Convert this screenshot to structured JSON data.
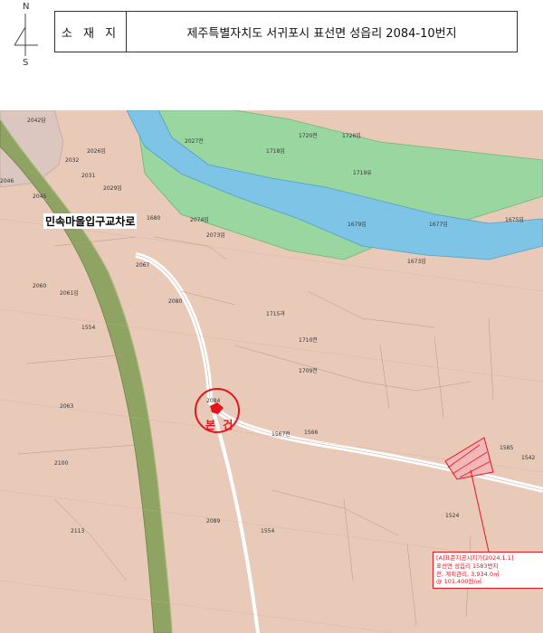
{
  "compass": {
    "north": "N",
    "south": "S"
  },
  "address": {
    "label": "소 재 지",
    "value": "제주특별자치도 서귀포시 표선면 성읍리 2084-10번지"
  },
  "place_label": "민속마을입구교차로",
  "subject_label": "본 건",
  "callout": {
    "line1": "[A]표준지공시지가[2024.1.1]",
    "line2": "표선면 성읍리 1583번지",
    "line3": "전, 계획관리, 3,934.0㎡",
    "line4": "@ 101,400원/㎡"
  },
  "parcel_labels": [
    {
      "text": "2042답",
      "l": 0.05,
      "t": 0.01
    },
    {
      "text": "2027전",
      "l": 0.34,
      "t": 0.05
    },
    {
      "text": "1718임",
      "l": 0.49,
      "t": 0.07
    },
    {
      "text": "1720전",
      "l": 0.55,
      "t": 0.04
    },
    {
      "text": "1726임",
      "l": 0.63,
      "t": 0.04
    },
    {
      "text": "2026임",
      "l": 0.16,
      "t": 0.07
    },
    {
      "text": "2032",
      "l": 0.12,
      "t": 0.09
    },
    {
      "text": "2031",
      "l": 0.15,
      "t": 0.12
    },
    {
      "text": "2029임",
      "l": 0.19,
      "t": 0.14
    },
    {
      "text": "1719유",
      "l": 0.65,
      "t": 0.11
    },
    {
      "text": "2046",
      "l": 0.0,
      "t": 0.13
    },
    {
      "text": "2045",
      "l": 0.06,
      "t": 0.16
    },
    {
      "text": "2074임",
      "l": 0.35,
      "t": 0.2
    },
    {
      "text": "1679임",
      "l": 0.64,
      "t": 0.21
    },
    {
      "text": "1677임",
      "l": 0.79,
      "t": 0.21
    },
    {
      "text": "1675임",
      "l": 0.93,
      "t": 0.2
    },
    {
      "text": "1680",
      "l": 0.27,
      "t": 0.2
    },
    {
      "text": "2073임",
      "l": 0.38,
      "t": 0.23
    },
    {
      "text": "1673임",
      "l": 0.75,
      "t": 0.28
    },
    {
      "text": "2067",
      "l": 0.25,
      "t": 0.29
    },
    {
      "text": "2060",
      "l": 0.06,
      "t": 0.33
    },
    {
      "text": "2061임",
      "l": 0.11,
      "t": 0.34
    },
    {
      "text": "2080",
      "l": 0.31,
      "t": 0.36
    },
    {
      "text": "1715과",
      "l": 0.49,
      "t": 0.38
    },
    {
      "text": "1554",
      "l": 0.15,
      "t": 0.41
    },
    {
      "text": "2063",
      "l": 0.11,
      "t": 0.56
    },
    {
      "text": "2084",
      "l": 0.38,
      "t": 0.55
    },
    {
      "text": "1710전",
      "l": 0.55,
      "t": 0.43
    },
    {
      "text": "1709전",
      "l": 0.55,
      "t": 0.49
    },
    {
      "text": "1567전",
      "l": 0.5,
      "t": 0.61
    },
    {
      "text": "1566",
      "l": 0.56,
      "t": 0.61
    },
    {
      "text": "1524",
      "l": 0.82,
      "t": 0.77
    },
    {
      "text": "1554",
      "l": 0.48,
      "t": 0.8
    },
    {
      "text": "2089",
      "l": 0.38,
      "t": 0.78
    },
    {
      "text": "2100",
      "l": 0.1,
      "t": 0.67
    },
    {
      "text": "2113",
      "l": 0.13,
      "t": 0.8
    },
    {
      "text": "1542",
      "l": 0.98,
      "t": 0.66
    },
    {
      "text": "1585",
      "l": 0.92,
      "t": 0.64
    }
  ]
}
